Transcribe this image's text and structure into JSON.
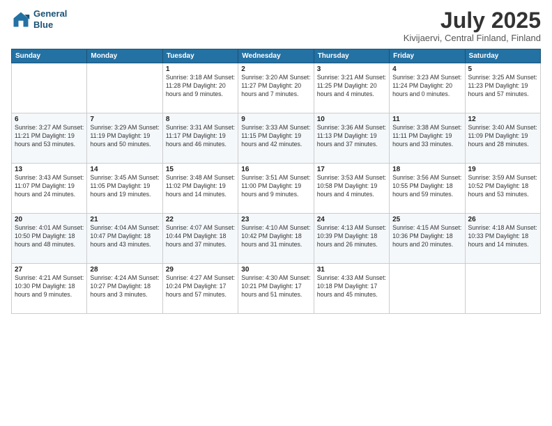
{
  "logo": {
    "line1": "General",
    "line2": "Blue"
  },
  "title": "July 2025",
  "subtitle": "Kivijaervi, Central Finland, Finland",
  "weekdays": [
    "Sunday",
    "Monday",
    "Tuesday",
    "Wednesday",
    "Thursday",
    "Friday",
    "Saturday"
  ],
  "weeks": [
    [
      {
        "day": "",
        "info": ""
      },
      {
        "day": "",
        "info": ""
      },
      {
        "day": "1",
        "info": "Sunrise: 3:18 AM\nSunset: 11:28 PM\nDaylight: 20 hours\nand 9 minutes."
      },
      {
        "day": "2",
        "info": "Sunrise: 3:20 AM\nSunset: 11:27 PM\nDaylight: 20 hours\nand 7 minutes."
      },
      {
        "day": "3",
        "info": "Sunrise: 3:21 AM\nSunset: 11:25 PM\nDaylight: 20 hours\nand 4 minutes."
      },
      {
        "day": "4",
        "info": "Sunrise: 3:23 AM\nSunset: 11:24 PM\nDaylight: 20 hours\nand 0 minutes."
      },
      {
        "day": "5",
        "info": "Sunrise: 3:25 AM\nSunset: 11:23 PM\nDaylight: 19 hours\nand 57 minutes."
      }
    ],
    [
      {
        "day": "6",
        "info": "Sunrise: 3:27 AM\nSunset: 11:21 PM\nDaylight: 19 hours\nand 53 minutes."
      },
      {
        "day": "7",
        "info": "Sunrise: 3:29 AM\nSunset: 11:19 PM\nDaylight: 19 hours\nand 50 minutes."
      },
      {
        "day": "8",
        "info": "Sunrise: 3:31 AM\nSunset: 11:17 PM\nDaylight: 19 hours\nand 46 minutes."
      },
      {
        "day": "9",
        "info": "Sunrise: 3:33 AM\nSunset: 11:15 PM\nDaylight: 19 hours\nand 42 minutes."
      },
      {
        "day": "10",
        "info": "Sunrise: 3:36 AM\nSunset: 11:13 PM\nDaylight: 19 hours\nand 37 minutes."
      },
      {
        "day": "11",
        "info": "Sunrise: 3:38 AM\nSunset: 11:11 PM\nDaylight: 19 hours\nand 33 minutes."
      },
      {
        "day": "12",
        "info": "Sunrise: 3:40 AM\nSunset: 11:09 PM\nDaylight: 19 hours\nand 28 minutes."
      }
    ],
    [
      {
        "day": "13",
        "info": "Sunrise: 3:43 AM\nSunset: 11:07 PM\nDaylight: 19 hours\nand 24 minutes."
      },
      {
        "day": "14",
        "info": "Sunrise: 3:45 AM\nSunset: 11:05 PM\nDaylight: 19 hours\nand 19 minutes."
      },
      {
        "day": "15",
        "info": "Sunrise: 3:48 AM\nSunset: 11:02 PM\nDaylight: 19 hours\nand 14 minutes."
      },
      {
        "day": "16",
        "info": "Sunrise: 3:51 AM\nSunset: 11:00 PM\nDaylight: 19 hours\nand 9 minutes."
      },
      {
        "day": "17",
        "info": "Sunrise: 3:53 AM\nSunset: 10:58 PM\nDaylight: 19 hours\nand 4 minutes."
      },
      {
        "day": "18",
        "info": "Sunrise: 3:56 AM\nSunset: 10:55 PM\nDaylight: 18 hours\nand 59 minutes."
      },
      {
        "day": "19",
        "info": "Sunrise: 3:59 AM\nSunset: 10:52 PM\nDaylight: 18 hours\nand 53 minutes."
      }
    ],
    [
      {
        "day": "20",
        "info": "Sunrise: 4:01 AM\nSunset: 10:50 PM\nDaylight: 18 hours\nand 48 minutes."
      },
      {
        "day": "21",
        "info": "Sunrise: 4:04 AM\nSunset: 10:47 PM\nDaylight: 18 hours\nand 43 minutes."
      },
      {
        "day": "22",
        "info": "Sunrise: 4:07 AM\nSunset: 10:44 PM\nDaylight: 18 hours\nand 37 minutes."
      },
      {
        "day": "23",
        "info": "Sunrise: 4:10 AM\nSunset: 10:42 PM\nDaylight: 18 hours\nand 31 minutes."
      },
      {
        "day": "24",
        "info": "Sunrise: 4:13 AM\nSunset: 10:39 PM\nDaylight: 18 hours\nand 26 minutes."
      },
      {
        "day": "25",
        "info": "Sunrise: 4:15 AM\nSunset: 10:36 PM\nDaylight: 18 hours\nand 20 minutes."
      },
      {
        "day": "26",
        "info": "Sunrise: 4:18 AM\nSunset: 10:33 PM\nDaylight: 18 hours\nand 14 minutes."
      }
    ],
    [
      {
        "day": "27",
        "info": "Sunrise: 4:21 AM\nSunset: 10:30 PM\nDaylight: 18 hours\nand 9 minutes."
      },
      {
        "day": "28",
        "info": "Sunrise: 4:24 AM\nSunset: 10:27 PM\nDaylight: 18 hours\nand 3 minutes."
      },
      {
        "day": "29",
        "info": "Sunrise: 4:27 AM\nSunset: 10:24 PM\nDaylight: 17 hours\nand 57 minutes."
      },
      {
        "day": "30",
        "info": "Sunrise: 4:30 AM\nSunset: 10:21 PM\nDaylight: 17 hours\nand 51 minutes."
      },
      {
        "day": "31",
        "info": "Sunrise: 4:33 AM\nSunset: 10:18 PM\nDaylight: 17 hours\nand 45 minutes."
      },
      {
        "day": "",
        "info": ""
      },
      {
        "day": "",
        "info": ""
      }
    ]
  ]
}
